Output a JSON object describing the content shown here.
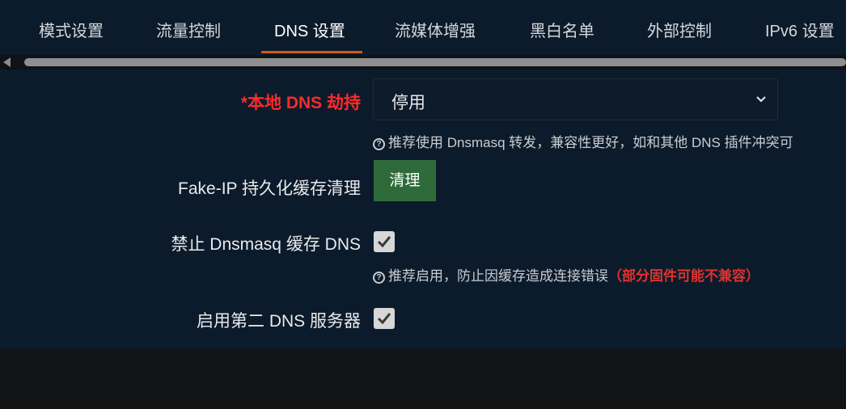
{
  "tabs": [
    {
      "label": "模式设置",
      "active": false
    },
    {
      "label": "流量控制",
      "active": false
    },
    {
      "label": "DNS 设置",
      "active": true
    },
    {
      "label": "流媒体增强",
      "active": false
    },
    {
      "label": "黑白名单",
      "active": false
    },
    {
      "label": "外部控制",
      "active": false
    },
    {
      "label": "IPv6 设置",
      "active": false
    }
  ],
  "dns_hijack": {
    "label": "*本地 DNS 劫持",
    "value": "停用",
    "help": "推荐使用 Dnsmasq 转发，兼容性更好，如和其他 DNS 插件冲突可"
  },
  "fakeip_cache": {
    "label": "Fake-IP 持久化缓存清理",
    "button": "清理"
  },
  "dnsmasq_cache": {
    "label": "禁止 Dnsmasq 缓存 DNS",
    "checked": true,
    "help": "推荐启用，防止因缓存造成连接错误",
    "warning": "（部分固件可能不兼容）"
  },
  "second_dns": {
    "label": "启用第二 DNS 服务器",
    "checked": true
  },
  "colors": {
    "required": "#ff2a2a",
    "button": "#2f6b3a",
    "active_underline": "#d05a18",
    "warning": "#e1322d"
  }
}
